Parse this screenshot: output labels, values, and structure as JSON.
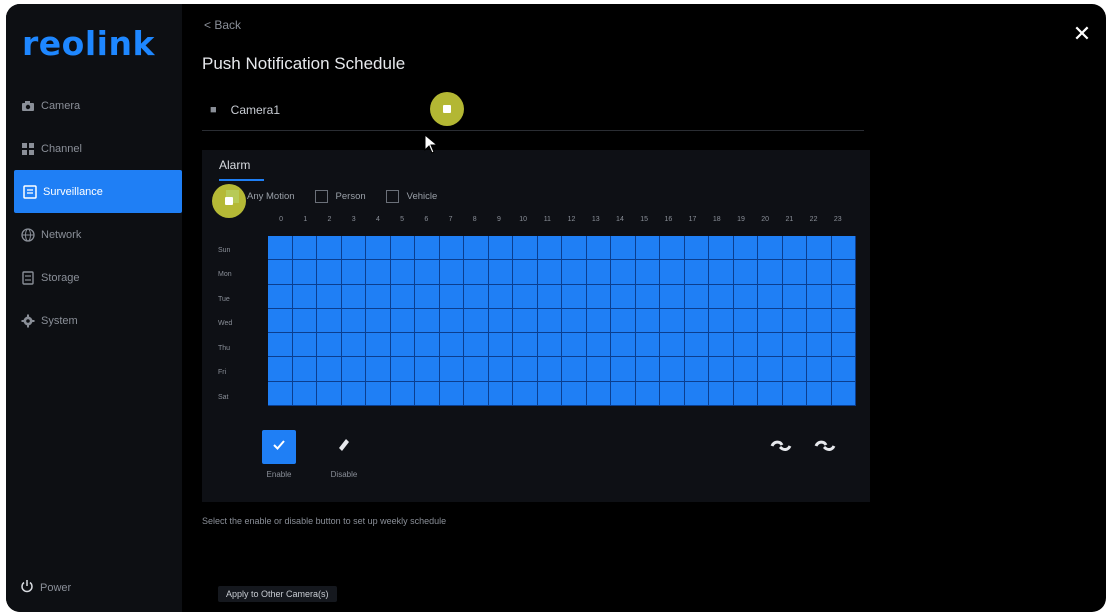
{
  "app": {
    "logo": "reolink"
  },
  "sidebar": {
    "items": [
      {
        "label": "Camera",
        "icon": "camera-icon",
        "active": false
      },
      {
        "label": "Channel",
        "icon": "channel-icon",
        "active": false
      },
      {
        "label": "Surveillance",
        "icon": "surveillance-icon",
        "active": true
      },
      {
        "label": "Network",
        "icon": "globe-icon",
        "active": false
      },
      {
        "label": "Storage",
        "icon": "storage-icon",
        "active": false
      },
      {
        "label": "System",
        "icon": "gear-icon",
        "active": false
      }
    ],
    "power_label": "Power"
  },
  "header": {
    "back_label": "< Back",
    "title": "Push Notification Schedule",
    "camera_name": "Camera1"
  },
  "panel": {
    "tab": "Alarm",
    "checks": [
      {
        "label": "Any Motion",
        "checked": true
      },
      {
        "label": "Person",
        "checked": false
      },
      {
        "label": "Vehicle",
        "checked": false
      }
    ],
    "hours": [
      "0",
      "1",
      "2",
      "3",
      "4",
      "5",
      "6",
      "7",
      "8",
      "9",
      "10",
      "11",
      "12",
      "13",
      "14",
      "15",
      "16",
      "17",
      "18",
      "19",
      "20",
      "21",
      "22",
      "23"
    ],
    "days": [
      "Sun",
      "Mon",
      "Tue",
      "Wed",
      "Thu",
      "Fri",
      "Sat"
    ],
    "enable_label": "Enable",
    "disable_label": "Disable"
  },
  "hint": "Select the enable or disable button to set up weekly schedule",
  "apply_label": "Apply to Other Camera(s)",
  "colors": {
    "accent": "#1f7ff5",
    "background": "#000000",
    "marker": "#d2d73c"
  }
}
